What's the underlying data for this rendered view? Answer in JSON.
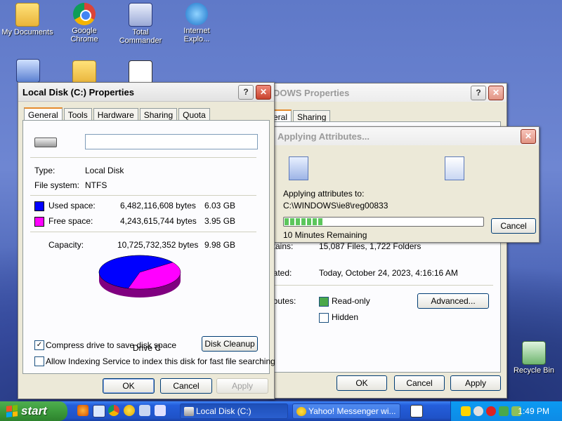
{
  "desktop": {
    "icons": [
      {
        "label": "My Documents"
      },
      {
        "label": "Google Chrome"
      },
      {
        "label": "Total Commander"
      },
      {
        "label": "Internet Explo..."
      },
      {
        "label": "Recycle Bin"
      }
    ]
  },
  "local_disk_window": {
    "title": "Local Disk (C:) Properties",
    "tabs": [
      "General",
      "Tools",
      "Hardware",
      "Sharing",
      "Quota"
    ],
    "type_label": "Type:",
    "type_value": "Local Disk",
    "fs_label": "File system:",
    "fs_value": "NTFS",
    "used_label": "Used space:",
    "used_bytes": "6,482,116,608 bytes",
    "used_gb": "6.03 GB",
    "free_label": "Free space:",
    "free_bytes": "4,243,615,744 bytes",
    "free_gb": "3.95 GB",
    "capacity_label": "Capacity:",
    "capacity_bytes": "10,725,732,352 bytes",
    "capacity_gb": "9.98 GB",
    "drive_label": "Drive C",
    "disk_cleanup": "Disk Cleanup",
    "compress_label": "Compress drive to save disk space",
    "index_label": "Allow Indexing Service to index this disk for fast file searching",
    "ok": "OK",
    "cancel": "Cancel",
    "apply": "Apply",
    "used_fraction": 0.604,
    "colors": {
      "used": "#0000ff",
      "free": "#ff00ff"
    }
  },
  "windows_props_window": {
    "title": "DOWS Properties",
    "tabs": [
      "eral",
      "Sharing"
    ],
    "contains_label": "ntains:",
    "contains_value": "15,087 Files, 1,722 Folders",
    "created_label": "eated:",
    "created_value": "Today, October 24, 2023, 4:16:16 AM",
    "attributes_label": "ributes:",
    "readonly_label": "Read-only",
    "hidden_label": "Hidden",
    "advanced": "Advanced...",
    "ok": "OK",
    "cancel": "Cancel",
    "apply": "Apply"
  },
  "apply_dialog": {
    "title": "Applying Attributes...",
    "applying_to": "Applying attributes to:",
    "path": "C:\\WINDOWS\\ie8\\reg00833",
    "remaining": "10 Minutes Remaining",
    "cancel": "Cancel",
    "progress": 0.2
  },
  "taskbar": {
    "start": "start",
    "items": [
      {
        "label": "Local Disk (C:)"
      },
      {
        "label": "Yahoo! Messenger wi..."
      }
    ],
    "clock": "1:49 PM"
  }
}
